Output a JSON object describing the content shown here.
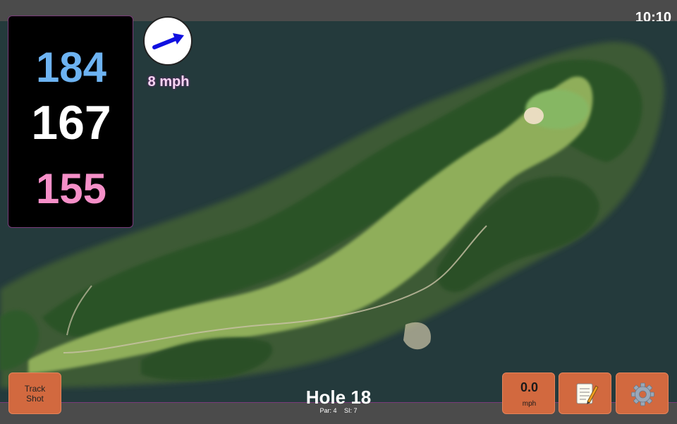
{
  "status": {
    "time": "10:10"
  },
  "distances": {
    "back": "184",
    "middle": "167",
    "front": "155"
  },
  "wind": {
    "speed_label": "8 mph",
    "arrow_icon": "wind-direction-arrow-icon",
    "arrow_color": "#1010e0"
  },
  "hole": {
    "title": "Hole 18",
    "par": "Par: 4",
    "stroke_index": "SI: 7"
  },
  "buttons": {
    "track_shot_line1": "Track",
    "track_shot_line2": "Shot",
    "speed_value": "0.0",
    "speed_unit": "mph",
    "notes_icon": "notepad-icon",
    "settings_icon": "gear-icon"
  },
  "colors": {
    "back_distance": "#6db3f2",
    "middle_distance": "#ffffff",
    "front_distance": "#f58fc8",
    "button": "#d2693f",
    "water": "#243a3c",
    "fairway": "#8fae5a",
    "trees": "#2e5a2a"
  }
}
